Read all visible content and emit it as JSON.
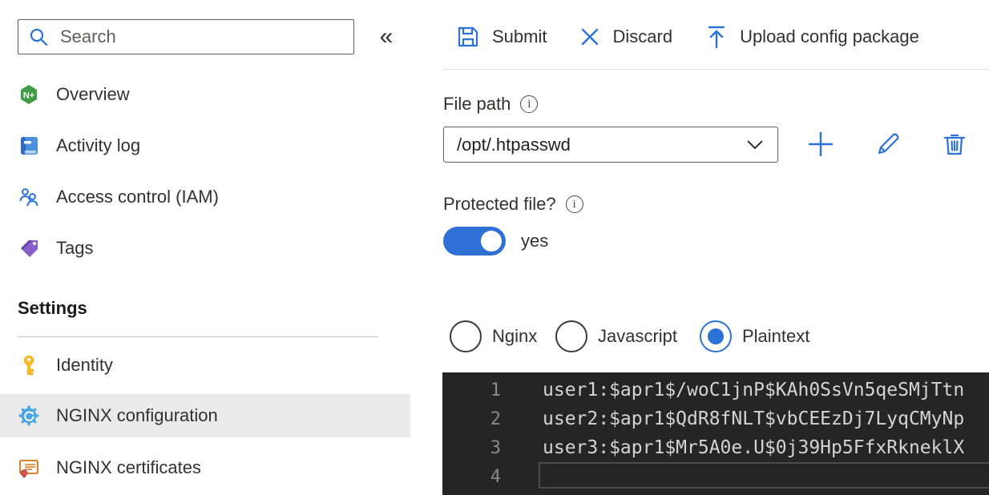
{
  "sidebar": {
    "search": {
      "placeholder": "Search"
    },
    "collapse_glyph": "«",
    "items": [
      {
        "label": "Overview",
        "icon": "nginx-overview-icon"
      },
      {
        "label": "Activity log",
        "icon": "activity-log-icon"
      },
      {
        "label": "Access control (IAM)",
        "icon": "access-control-icon"
      },
      {
        "label": "Tags",
        "icon": "tags-icon"
      }
    ],
    "settings_header": "Settings",
    "settings_items": [
      {
        "label": "Identity",
        "icon": "key-icon",
        "selected": false
      },
      {
        "label": "NGINX configuration",
        "icon": "gear-sync-icon",
        "selected": true
      },
      {
        "label": "NGINX certificates",
        "icon": "certificate-icon",
        "selected": false
      }
    ]
  },
  "toolbar": {
    "submit_label": "Submit",
    "discard_label": "Discard",
    "upload_label": "Upload config package"
  },
  "file_path": {
    "label": "File path",
    "value": "/opt/.htpasswd"
  },
  "protected_file": {
    "label": "Protected file?",
    "state_label": "yes",
    "enabled": true
  },
  "syntax_options": [
    {
      "label": "Nginx",
      "selected": false
    },
    {
      "label": "Javascript",
      "selected": false
    },
    {
      "label": "Plaintext",
      "selected": true
    }
  ],
  "editor": {
    "lines": [
      {
        "number": "1",
        "text": "user1:$apr1$/woC1jnP$KAh0SsVn5qeSMjTtn"
      },
      {
        "number": "2",
        "text": "user2:$apr1$QdR8fNLT$vbCEEzDj7LyqCMyNp"
      },
      {
        "number": "3",
        "text": "user3:$apr1$Mr5A0e.U$0j39Hp5FfxRkneklX"
      },
      {
        "number": "4",
        "text": "",
        "current": true
      }
    ]
  },
  "icons": {
    "overview_badge": "N+"
  },
  "colors": {
    "accent_blue": "#2b72d8",
    "toggle_on": "#2f70d5",
    "selected_row_bg": "#eaeaea",
    "editor_bg": "#252526",
    "editor_text": "#d4d4d4",
    "editor_gutter": "#8a8a8a"
  }
}
